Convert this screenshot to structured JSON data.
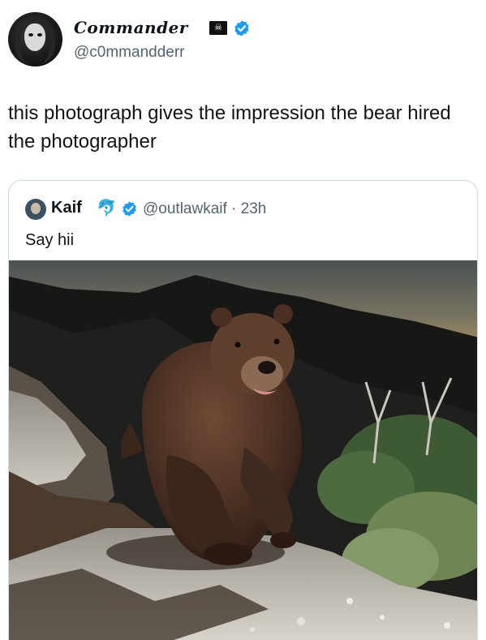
{
  "author": {
    "display_name": "Commander",
    "badge_icon": "pirate-flag-icon",
    "verified_icon": "verified-badge-icon",
    "handle": "@c0mmandderr"
  },
  "tweet": {
    "text": "this photograph gives the impression the bear hired the photographer"
  },
  "quote": {
    "display_name": "Kaif",
    "emoji_icon": "dolphin-icon",
    "verified_icon": "verified-badge-icon",
    "handle": "@outlawkaif",
    "time": "23h",
    "handle_time": "@outlawkaif · 23h",
    "text": "Say hii",
    "media": "photo-bear-walking-on-rocky-ridge-at-dusk"
  },
  "colors": {
    "text_primary": "#0f1419",
    "text_secondary": "#536471",
    "verified_blue": "#1d9bf0",
    "card_border": "#cfd9de"
  }
}
